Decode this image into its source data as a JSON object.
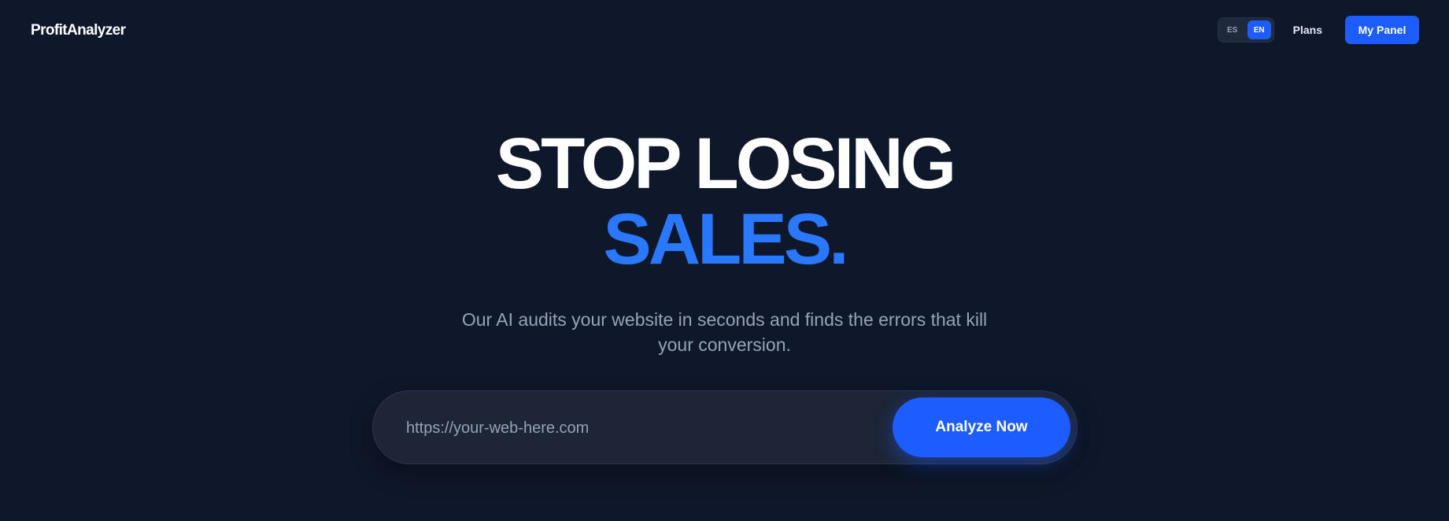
{
  "brand": {
    "name": "ProfitAnalyzer"
  },
  "nav": {
    "languages": [
      {
        "code": "ES",
        "active": false
      },
      {
        "code": "EN",
        "active": true
      }
    ],
    "plans_label": "Plans",
    "panel_label": "My Panel"
  },
  "hero": {
    "headline_line1": "STOP LOSING",
    "headline_line2": "SALES.",
    "subtitle": "Our AI audits your website in seconds and finds the errors that kill your conversion."
  },
  "search": {
    "placeholder": "https://your-web-here.com",
    "value": "",
    "button_label": "Analyze Now"
  },
  "colors": {
    "background": "#0f172a",
    "accent": "#1d5cff",
    "headline_accent": "#2a78ff",
    "muted_text": "#94a3b8"
  }
}
